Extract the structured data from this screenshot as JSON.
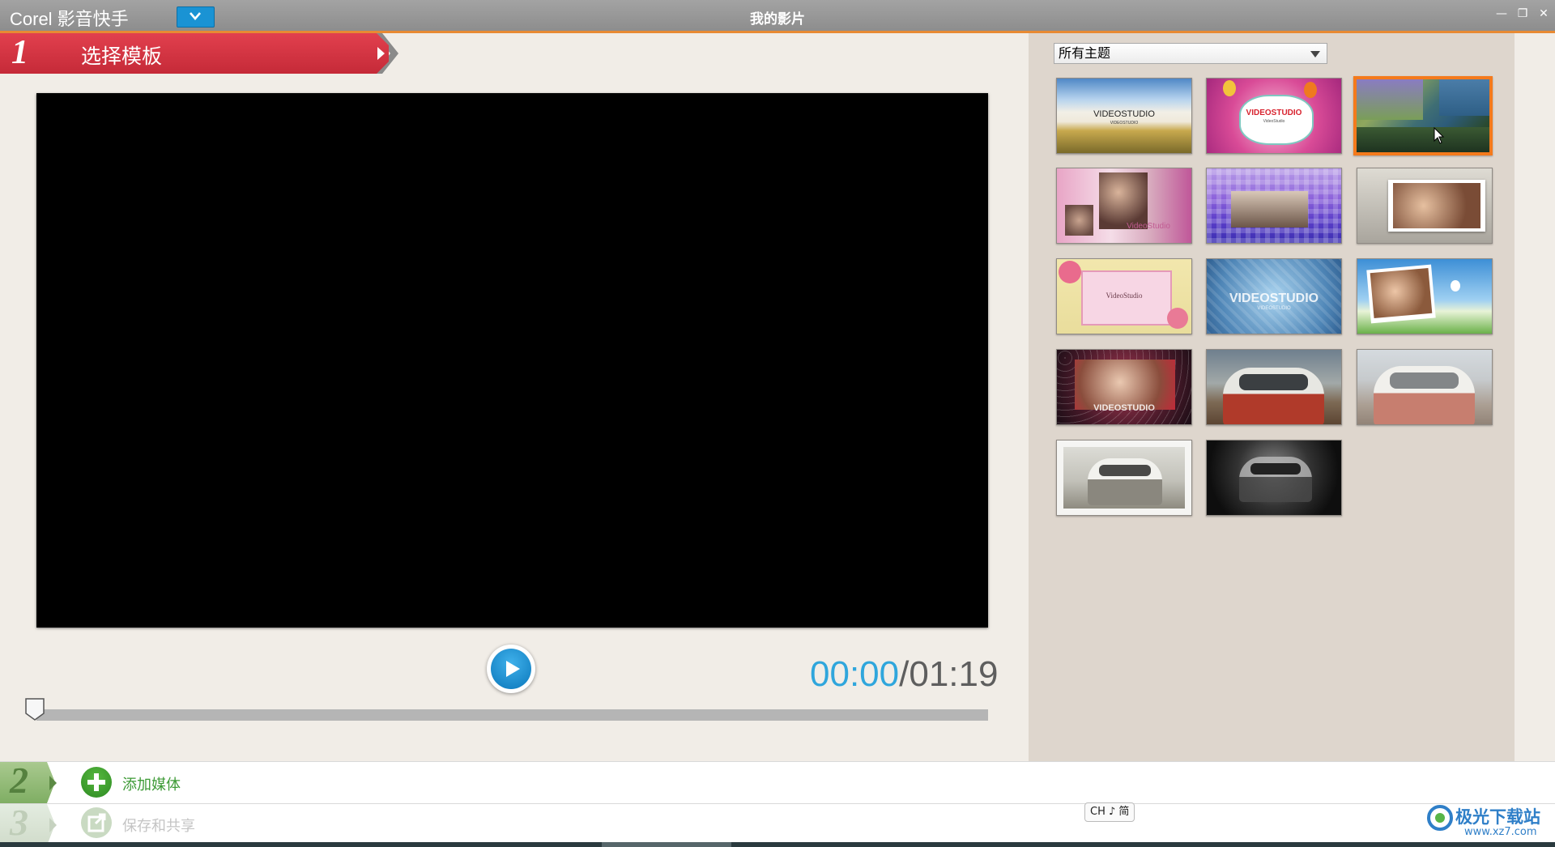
{
  "titlebar": {
    "app_name": "Corel 影音快手",
    "window_title": "我的影片",
    "minimize_glyph": "—",
    "restore_glyph": "❐",
    "close_glyph": "✕"
  },
  "step1": {
    "number": "1",
    "label": "选择模板"
  },
  "player": {
    "current_time": "00:00",
    "separator": "/",
    "total_time": "01:19",
    "progress_fraction": 0.0
  },
  "theme_filter": {
    "selected": "所有主题"
  },
  "templates": [
    {
      "id": "t1",
      "text": "VIDEOSTUDIO",
      "subtext": "VIDEOSTUDIO",
      "selected": false
    },
    {
      "id": "t2",
      "text": "VIDEOSTUDIO",
      "subtext": "VideoStudio",
      "selected": false
    },
    {
      "id": "t3",
      "text": "",
      "selected": true
    },
    {
      "id": "t4",
      "text": "VideoStudio",
      "selected": false
    },
    {
      "id": "t5",
      "text": "",
      "selected": false
    },
    {
      "id": "t6",
      "text": "",
      "selected": false
    },
    {
      "id": "t7",
      "text": "VideoStudio",
      "selected": false
    },
    {
      "id": "t8",
      "text": "VIDEOSTUDIO",
      "subtext": "VIDEOSTUDIO",
      "selected": false
    },
    {
      "id": "t9",
      "text": "",
      "selected": false
    },
    {
      "id": "t10",
      "text": "VIDEOSTUDIO",
      "selected": false
    },
    {
      "id": "t11",
      "text": "",
      "selected": false
    },
    {
      "id": "t12",
      "text": "",
      "selected": false
    },
    {
      "id": "t13",
      "text": "",
      "selected": false
    },
    {
      "id": "t14",
      "text": "",
      "selected": false
    }
  ],
  "step2": {
    "number": "2",
    "label": "添加媒体"
  },
  "step3": {
    "number": "3",
    "label": "保存和共享"
  },
  "ime": {
    "label": "CH ♪ 简"
  },
  "watermark": {
    "main": "极光下载站",
    "sub": "www.xz7.com"
  },
  "colors": {
    "accent_red": "#d6333f",
    "accent_blue": "#2fa6dc",
    "selected_border": "#f47a1c",
    "step2_green": "#3c9a35"
  }
}
